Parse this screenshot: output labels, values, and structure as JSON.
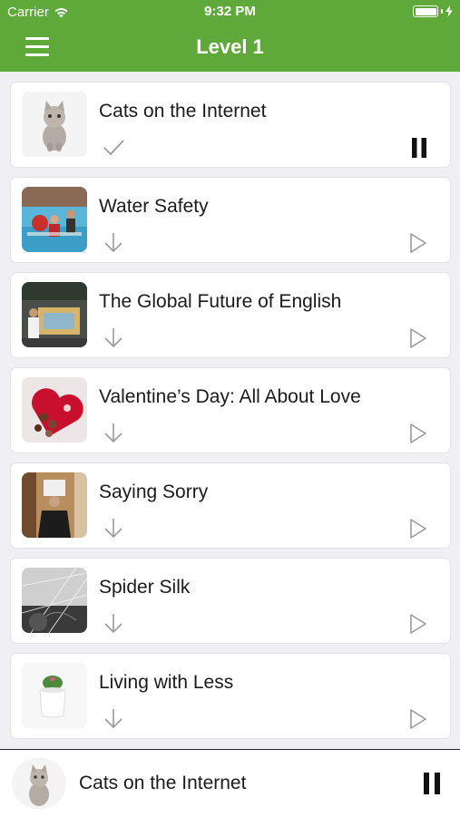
{
  "status_bar": {
    "carrier": "Carrier",
    "time": "9:32 PM"
  },
  "nav": {
    "title": "Level 1",
    "menu_icon": "hamburger-menu-icon"
  },
  "lessons": [
    {
      "title": "Cats on the Internet",
      "status": "downloaded",
      "playback": "playing"
    },
    {
      "title": "Water Safety",
      "status": "download",
      "playback": "play"
    },
    {
      "title": "The Global Future of English",
      "status": "download",
      "playback": "play"
    },
    {
      "title": "Valentine’s Day: All About Love",
      "status": "download",
      "playback": "play"
    },
    {
      "title": "Saying Sorry",
      "status": "download",
      "playback": "play"
    },
    {
      "title": "Spider Silk",
      "status": "download",
      "playback": "play"
    },
    {
      "title": "Living with Less",
      "status": "download",
      "playback": "play"
    }
  ],
  "now_playing": {
    "title": "Cats on the Internet",
    "playback": "playing"
  },
  "colors": {
    "accent": "#5fa83a",
    "background": "#efeff4",
    "icon_gray": "#9a9a9a"
  }
}
